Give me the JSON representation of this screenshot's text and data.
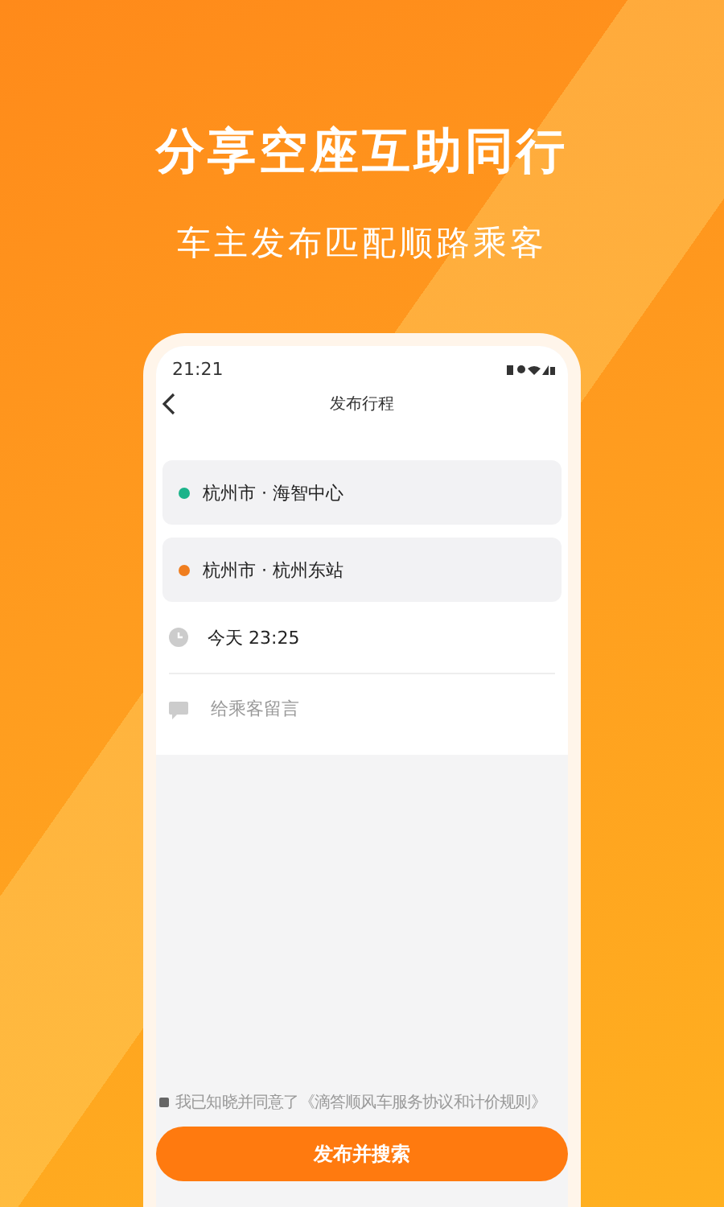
{
  "headline": "分享空座互助同行",
  "subheadline": "车主发布匹配顺路乘客",
  "phone": {
    "status_bar": {
      "time": "21:21"
    },
    "nav": {
      "title": "发布行程"
    },
    "route": [
      {
        "text": "杭州市 · 海智中心",
        "color": "#1bb38a"
      },
      {
        "text": "杭州市 · 杭州东站",
        "color": "#f07e1f"
      }
    ],
    "time": {
      "value": "今天 23:25"
    },
    "message": {
      "placeholder": "给乘客留言"
    },
    "agreement": {
      "text": "我已知晓并同意了《滴答顺风车服务协议和计价规则》",
      "checked": false
    },
    "submit_button": "发布并搜索"
  }
}
